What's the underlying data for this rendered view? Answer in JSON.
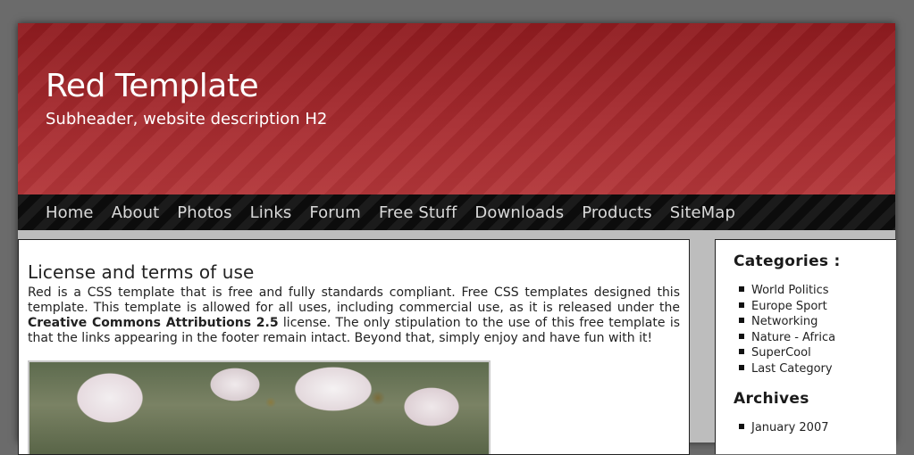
{
  "header": {
    "title": "Red Template",
    "subtitle": "Subheader, website description H2"
  },
  "nav": {
    "items": [
      "Home",
      "About",
      "Photos",
      "Links",
      "Forum",
      "Free Stuff",
      "Downloads",
      "Products",
      "SiteMap"
    ]
  },
  "main": {
    "heading": "License and terms of use",
    "intro_before": "Red is a CSS template that is free and fully standards compliant. Free CSS templates designed this template. This template is allowed for all uses, including commercial use, as it is released under the ",
    "intro_bold": "Creative Commons Attributions 2.5",
    "intro_after": " license. The only stipulation to the use of this free template is that the links appearing in the footer remain intact. Beyond that, simply enjoy and have fun with it!"
  },
  "sidebar": {
    "categories_heading": "Categories :",
    "categories": [
      "World Politics",
      "Europe Sport",
      "Networking",
      "Nature - Africa",
      "SuperCool",
      "Last Category"
    ],
    "archives_heading": "Archives",
    "archives": [
      "January 2007"
    ]
  },
  "colors": {
    "header_red": "#a82a2e",
    "nav_black": "#141414",
    "page_gray": "#6b6b6b"
  }
}
